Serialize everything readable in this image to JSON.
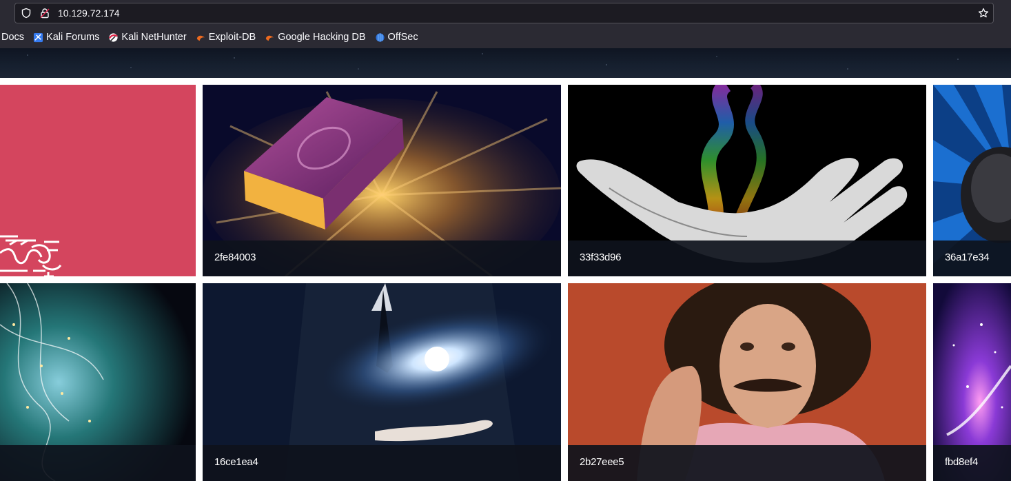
{
  "browser": {
    "url": "10.129.72.174",
    "bookmarks": [
      {
        "label": "Docs",
        "icon": "none"
      },
      {
        "label": "Kali Forums",
        "icon": "kali-forums-icon"
      },
      {
        "label": "Kali NetHunter",
        "icon": "kali-nethunter-icon"
      },
      {
        "label": "Exploit-DB",
        "icon": "exploit-db-icon"
      },
      {
        "label": "Google Hacking DB",
        "icon": "google-hacking-db-icon"
      },
      {
        "label": "OffSec",
        "icon": "offsec-icon"
      }
    ]
  },
  "gallery": {
    "row1": [
      {
        "caption": "",
        "image": "pink-magic-text-tile"
      },
      {
        "caption": "2fe84003",
        "image": "glowing-book"
      },
      {
        "caption": "33f33d96",
        "image": "hand-rainbow-smoke"
      },
      {
        "caption": "36a17e34",
        "image": "blue-rays-hat"
      }
    ],
    "row2": [
      {
        "caption": "",
        "image": "swirling-light-cauldron"
      },
      {
        "caption": "16ce1ea4",
        "image": "hands-galaxy"
      },
      {
        "caption": "2b27eee5",
        "image": "man-mustache-magic"
      },
      {
        "caption": "fbd8ef4",
        "image": "purple-sparkle"
      }
    ]
  },
  "colors": {
    "chrome_bg": "#2b2a33",
    "urlbar_bg": "#1c1b22",
    "caption_bg": "#0e121c",
    "pink_tile": "#d4455e"
  }
}
